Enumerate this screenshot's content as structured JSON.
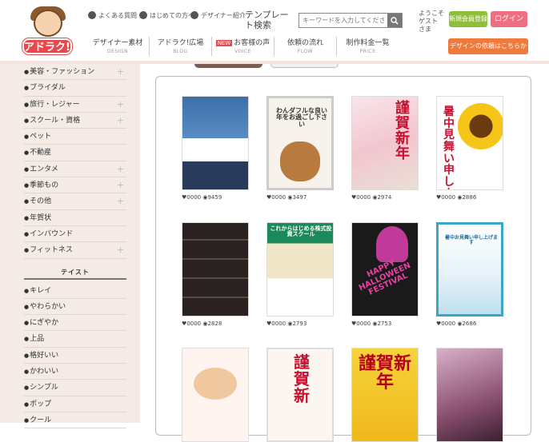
{
  "header": {
    "logo_text": "アドラク!",
    "util_links": [
      {
        "label": "よくある質問",
        "icon": "question-icon"
      },
      {
        "label": "はじめての方へ",
        "icon": "book-icon"
      },
      {
        "label": "デザイナー紹介",
        "icon": "user-icon"
      }
    ],
    "template_search_label": "テンプレート検索",
    "search_placeholder": "キーワードを入力してください",
    "welcome": "ようこそ ゲスト さま",
    "register_label": "新規会員登録",
    "login_label": "ログイン",
    "nav": [
      {
        "label": "デザイナー素材",
        "sub": "DESIGN",
        "badge": ""
      },
      {
        "label": "アドラク!広場",
        "sub": "BLOG",
        "badge": ""
      },
      {
        "label": "お客様の声",
        "sub": "VOICE",
        "badge": "NEW"
      },
      {
        "label": "依頼の流れ",
        "sub": "FLOW",
        "badge": ""
      },
      {
        "label": "制作料金一覧",
        "sub": "PRICE",
        "badge": ""
      }
    ],
    "cta_label": "デザインの依頼はこちらから",
    "cta_arrow": "›"
  },
  "sidebar": {
    "categories": [
      {
        "label": "美容・ファッション",
        "plus": true
      },
      {
        "label": "ブライダル",
        "plus": false
      },
      {
        "label": "旅行・レジャー",
        "plus": true
      },
      {
        "label": "スクール・資格",
        "plus": true
      },
      {
        "label": "ペット",
        "plus": false
      },
      {
        "label": "不動産",
        "plus": false
      },
      {
        "label": "エンタメ",
        "plus": true
      },
      {
        "label": "季節もの",
        "plus": true
      },
      {
        "label": "その他",
        "plus": true
      },
      {
        "label": "年賀状",
        "plus": false
      },
      {
        "label": "インバウンド",
        "plus": false
      },
      {
        "label": "フィットネス",
        "plus": true
      }
    ],
    "taste_heading": "テイスト",
    "tastes": [
      "キレイ",
      "やわらかい",
      "にぎやか",
      "上品",
      "格好いい",
      "かわいい",
      "シンプル",
      "ポップ",
      "クール"
    ]
  },
  "templates": [
    {
      "likes": "0000",
      "views": "9459",
      "kind": "school-photo",
      "text": ""
    },
    {
      "likes": "0000",
      "views": "3497",
      "kind": "dog",
      "text": "わんダフルな良い年をお過ごし下さい"
    },
    {
      "likes": "0000",
      "views": "2974",
      "kind": "nenga-sakura",
      "text": "謹賀新年"
    },
    {
      "likes": "0000",
      "views": "2886",
      "kind": "sunflower",
      "text": "暑中見舞い申し上げます"
    },
    {
      "likes": "0000",
      "views": "2828",
      "kind": "dark-grid",
      "text": ""
    },
    {
      "likes": "0000",
      "views": "2793",
      "kind": "stock-school",
      "text": "これからはじめる株式投資スクール"
    },
    {
      "likes": "0000",
      "views": "2753",
      "kind": "halloween",
      "text": "HAPPY HALLOWEEN FESTIVAL"
    },
    {
      "likes": "0000",
      "views": "2686",
      "kind": "polar",
      "text": "暑中お見舞い申し上げます"
    },
    {
      "likes": "",
      "views": "",
      "kind": "cake",
      "text": ""
    },
    {
      "likes": "",
      "views": "",
      "kind": "nenga-red",
      "text": "謹賀新"
    },
    {
      "likes": "",
      "views": "",
      "kind": "nenga-gold",
      "text": "謹賀新年"
    },
    {
      "likes": "",
      "views": "",
      "kind": "pink-photo",
      "text": ""
    }
  ],
  "icons": {
    "heart": "♥",
    "eye": "◉",
    "search": "🔍"
  },
  "colors": {
    "login": "#ef6f82",
    "register": "#8fbf3a",
    "cta": "#f07a3c",
    "sidebar_bg": "#f5ebe6",
    "new_badge": "#e8484a"
  }
}
